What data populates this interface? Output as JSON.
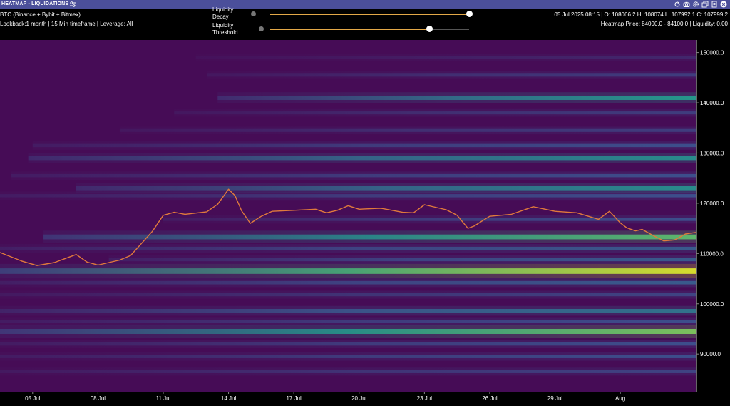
{
  "header": {
    "title": "HEATMAP - LIQUIDATIONS",
    "title_icon": "sliders-icon",
    "toolbar_icons": [
      "refresh-icon",
      "camera-icon",
      "settings-icon",
      "copy-icon",
      "duplicate-icon",
      "close-icon"
    ]
  },
  "info": {
    "line1": "BTC (Binance + Bybit + Bitmex)",
    "line2": "Lookback:1 month | 15 Min timeframe | Leverage: All",
    "ohlc": "05 Jul 2025 08:15 | O: 108066.2 H: 108074 L: 107992.1 C: 107999.2",
    "heatmap_info": "Heatmap Price: 84000.0 - 84100.0 | Liquidity: 0.00"
  },
  "sliders": [
    {
      "label_line1": "Liquidity",
      "label_line2": "Decay",
      "value": 1.0
    },
    {
      "label_line1": "Liquidity",
      "label_line2": "Threshold",
      "value": 0.8
    }
  ],
  "colors": {
    "background": "#460c56",
    "price_line": "#e07a3c",
    "band_low": "#3d4f8c",
    "band_mid": "#21a38a",
    "band_high": "#f5e61e",
    "axis_text": "#ffffff",
    "slider_fill": "#e2a848"
  },
  "chart_data": {
    "type": "heatmap",
    "x_tick_labels": [
      "05 Jul",
      "08 Jul",
      "11 Jul",
      "14 Jul",
      "17 Jul",
      "20 Jul",
      "23 Jul",
      "26 Jul",
      "29 Jul",
      "Aug"
    ],
    "y_tick_labels": [
      "150000.0",
      "140000.0",
      "130000.0",
      "120000.0",
      "110000.0",
      "100000.0",
      "90000.0"
    ],
    "y_ticks": [
      150000,
      140000,
      130000,
      120000,
      110000,
      100000,
      90000
    ],
    "ylim": [
      82500,
      152500
    ],
    "x_range_days": [
      3.5,
      35.5
    ],
    "price_series": {
      "x_day": [
        3.5,
        4.5,
        5.2,
        6.0,
        7.0,
        7.5,
        8.0,
        9.0,
        9.5,
        10.0,
        10.5,
        11.0,
        11.5,
        12.0,
        13.0,
        13.5,
        14.0,
        14.3,
        14.6,
        15.0,
        15.5,
        16.0,
        17.0,
        18.0,
        18.5,
        19.0,
        19.5,
        20.0,
        21.0,
        22.0,
        22.5,
        23.0,
        24.0,
        24.5,
        25.0,
        25.3,
        25.7,
        26.0,
        27.0,
        28.0,
        29.0,
        30.0,
        31.0,
        31.5,
        32.0,
        32.3,
        32.7,
        33.0,
        33.5,
        34.0,
        34.5,
        35.0,
        35.5
      ],
      "y_price": [
        110200,
        108500,
        107600,
        108200,
        109800,
        108300,
        107700,
        108700,
        109600,
        112000,
        114400,
        117600,
        118200,
        117800,
        118300,
        119800,
        122800,
        121500,
        118500,
        116000,
        117400,
        118400,
        118600,
        118800,
        118100,
        118600,
        119500,
        118800,
        119000,
        118200,
        118100,
        119700,
        118700,
        117600,
        115000,
        115500,
        116600,
        117400,
        117800,
        119300,
        118400,
        118100,
        116800,
        118400,
        116100,
        115100,
        114500,
        114800,
        113600,
        112500,
        112700,
        113900,
        114200
      ]
    },
    "bands": [
      {
        "price": 149000,
        "start_day": 12.5,
        "intensity": 0.12
      },
      {
        "price": 145500,
        "start_day": 13.0,
        "intensity": 0.22
      },
      {
        "price": 141000,
        "start_day": 13.5,
        "intensity": 0.6
      },
      {
        "price": 138000,
        "start_day": 11.5,
        "intensity": 0.22
      },
      {
        "price": 134500,
        "start_day": 9.0,
        "intensity": 0.22
      },
      {
        "price": 131500,
        "start_day": 5.0,
        "intensity": 0.3
      },
      {
        "price": 129000,
        "start_day": 4.8,
        "intensity": 0.55
      },
      {
        "price": 125500,
        "start_day": 4.0,
        "intensity": 0.3
      },
      {
        "price": 123000,
        "start_day": 7.0,
        "intensity": 0.55
      },
      {
        "price": 121500,
        "start_day": 3.5,
        "intensity": 0.3
      },
      {
        "price": 116800,
        "start_day": 11.0,
        "intensity": 0.3
      },
      {
        "price": 113300,
        "start_day": 5.5,
        "intensity": 0.75
      },
      {
        "price": 111000,
        "start_day": 3.5,
        "intensity": 0.35
      },
      {
        "price": 108800,
        "start_day": 8.5,
        "intensity": 0.35
      },
      {
        "price": 106500,
        "start_day": 3.5,
        "intensity": 0.95
      },
      {
        "price": 104200,
        "start_day": 3.5,
        "intensity": 0.35
      },
      {
        "price": 101800,
        "start_day": 3.5,
        "intensity": 0.25
      },
      {
        "price": 98600,
        "start_day": 3.5,
        "intensity": 0.45
      },
      {
        "price": 96500,
        "start_day": 3.5,
        "intensity": 0.3
      },
      {
        "price": 94500,
        "start_day": 3.5,
        "intensity": 0.8
      },
      {
        "price": 92000,
        "start_day": 3.5,
        "intensity": 0.3
      },
      {
        "price": 89500,
        "start_day": 3.5,
        "intensity": 0.3
      },
      {
        "price": 86500,
        "start_day": 3.5,
        "intensity": 0.25
      }
    ]
  }
}
